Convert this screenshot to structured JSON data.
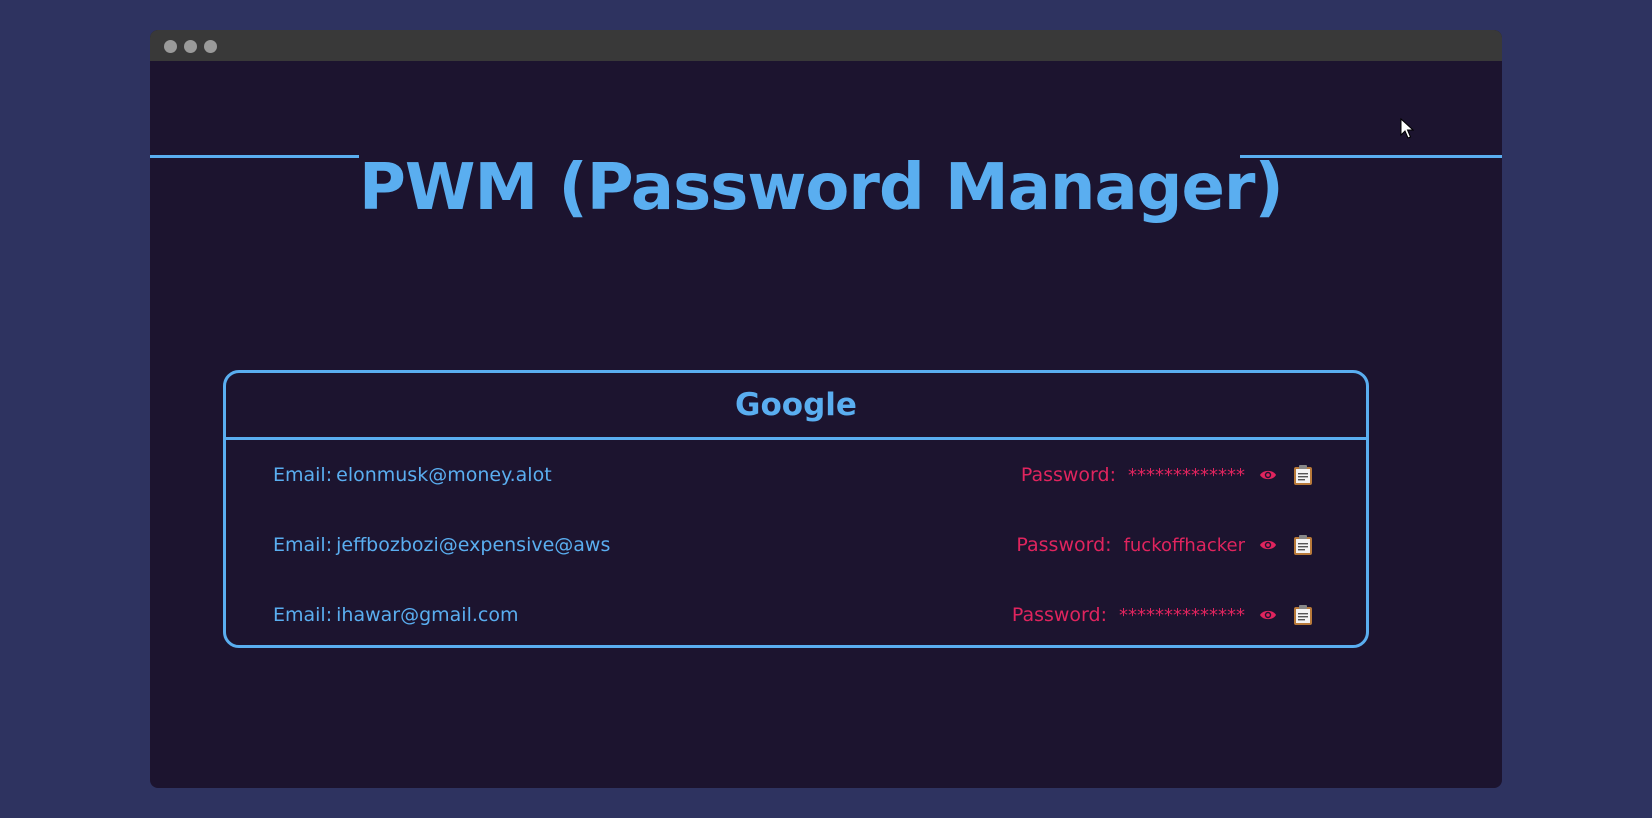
{
  "app": {
    "title": "PWM (Password Manager)"
  },
  "card": {
    "title": "Google",
    "entries": [
      {
        "email_label": "Email:",
        "email": "elonmusk@money.alot",
        "password_label": "Password:",
        "password": "*************",
        "visible": false
      },
      {
        "email_label": "Email:",
        "email": "jeffbozbozi@expensive@aws",
        "password_label": "Password:",
        "password": "fuckoffhacker",
        "visible": true
      },
      {
        "email_label": "Email:",
        "email": "ihawar@gmail.com",
        "password_label": "Password:",
        "password": "**************",
        "visible": false
      }
    ]
  },
  "icons": {
    "reveal": "eye-icon",
    "copy": "clipboard-icon"
  },
  "colors": {
    "background": "#2e3360",
    "window": "#1c142f",
    "accent": "#5aaef0",
    "password": "#e0245e"
  }
}
